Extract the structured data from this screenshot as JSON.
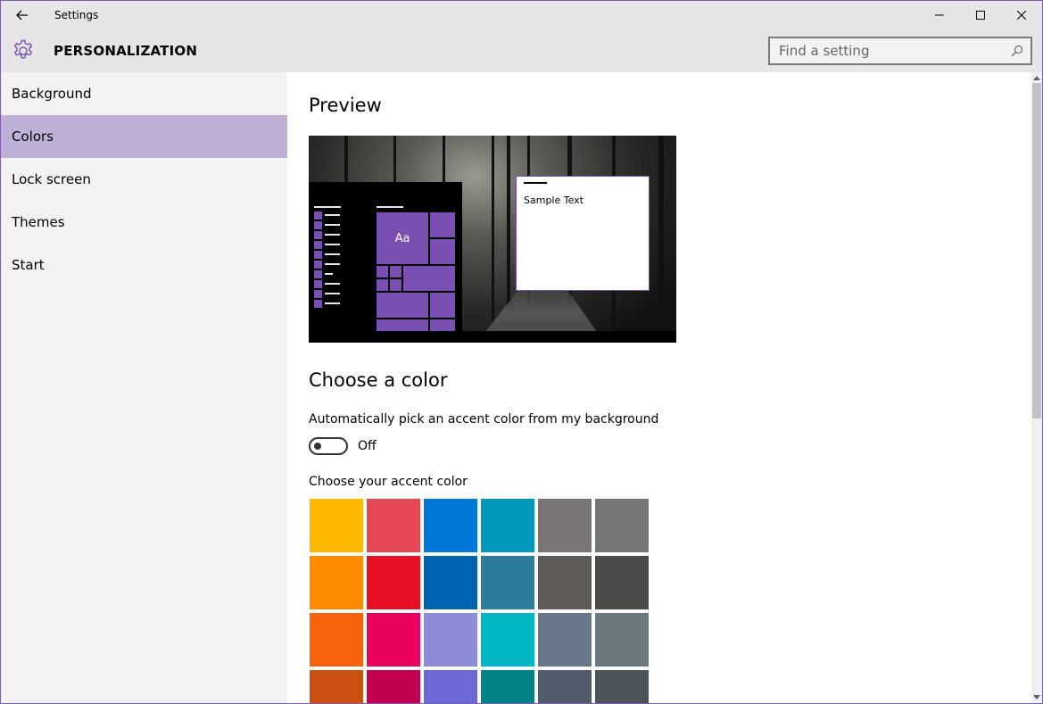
{
  "titlebar": {
    "title": "Settings",
    "back_icon": "back-arrow-icon",
    "minimize_icon": "minimize-icon",
    "maximize_icon": "maximize-icon",
    "close_icon": "close-icon"
  },
  "header": {
    "icon": "gear-icon",
    "title": "PERSONALIZATION",
    "search": {
      "placeholder": "Find a setting",
      "value": "",
      "icon": "search-icon"
    }
  },
  "sidebar": {
    "items": [
      {
        "label": "Background",
        "selected": false
      },
      {
        "label": "Colors",
        "selected": true
      },
      {
        "label": "Lock screen",
        "selected": false
      },
      {
        "label": "Themes",
        "selected": false
      },
      {
        "label": "Start",
        "selected": false
      }
    ]
  },
  "main": {
    "preview_title": "Preview",
    "preview": {
      "tile_text": "Aa",
      "sample_text": "Sample Text"
    },
    "choose_title": "Choose a color",
    "auto_pick_label": "Automatically pick an accent color from my background",
    "toggle": {
      "state": "Off"
    },
    "accent_label": "Choose your accent color",
    "accent_colors": [
      [
        "#ffb900",
        "#e74856",
        "#0078d7",
        "#0099bc",
        "#7a7574",
        "#767676"
      ],
      [
        "#ff8c00",
        "#e81123",
        "#0063b1",
        "#2d7d9a",
        "#5d5a58",
        "#4c4a48"
      ],
      [
        "#f7630c",
        "#ea005e",
        "#8e8cd8",
        "#00b7c3",
        "#68768a",
        "#69797e"
      ],
      [
        "#ca5010",
        "#c30052",
        "#6b69d6",
        "#038387",
        "#515c6b",
        "#4a5459"
      ]
    ]
  },
  "colors": {
    "accent": "#7a4fb2",
    "selected_nav": "#bfb0d8",
    "chrome": "#e6e6e6",
    "sidebar": "#f2f2f2"
  }
}
